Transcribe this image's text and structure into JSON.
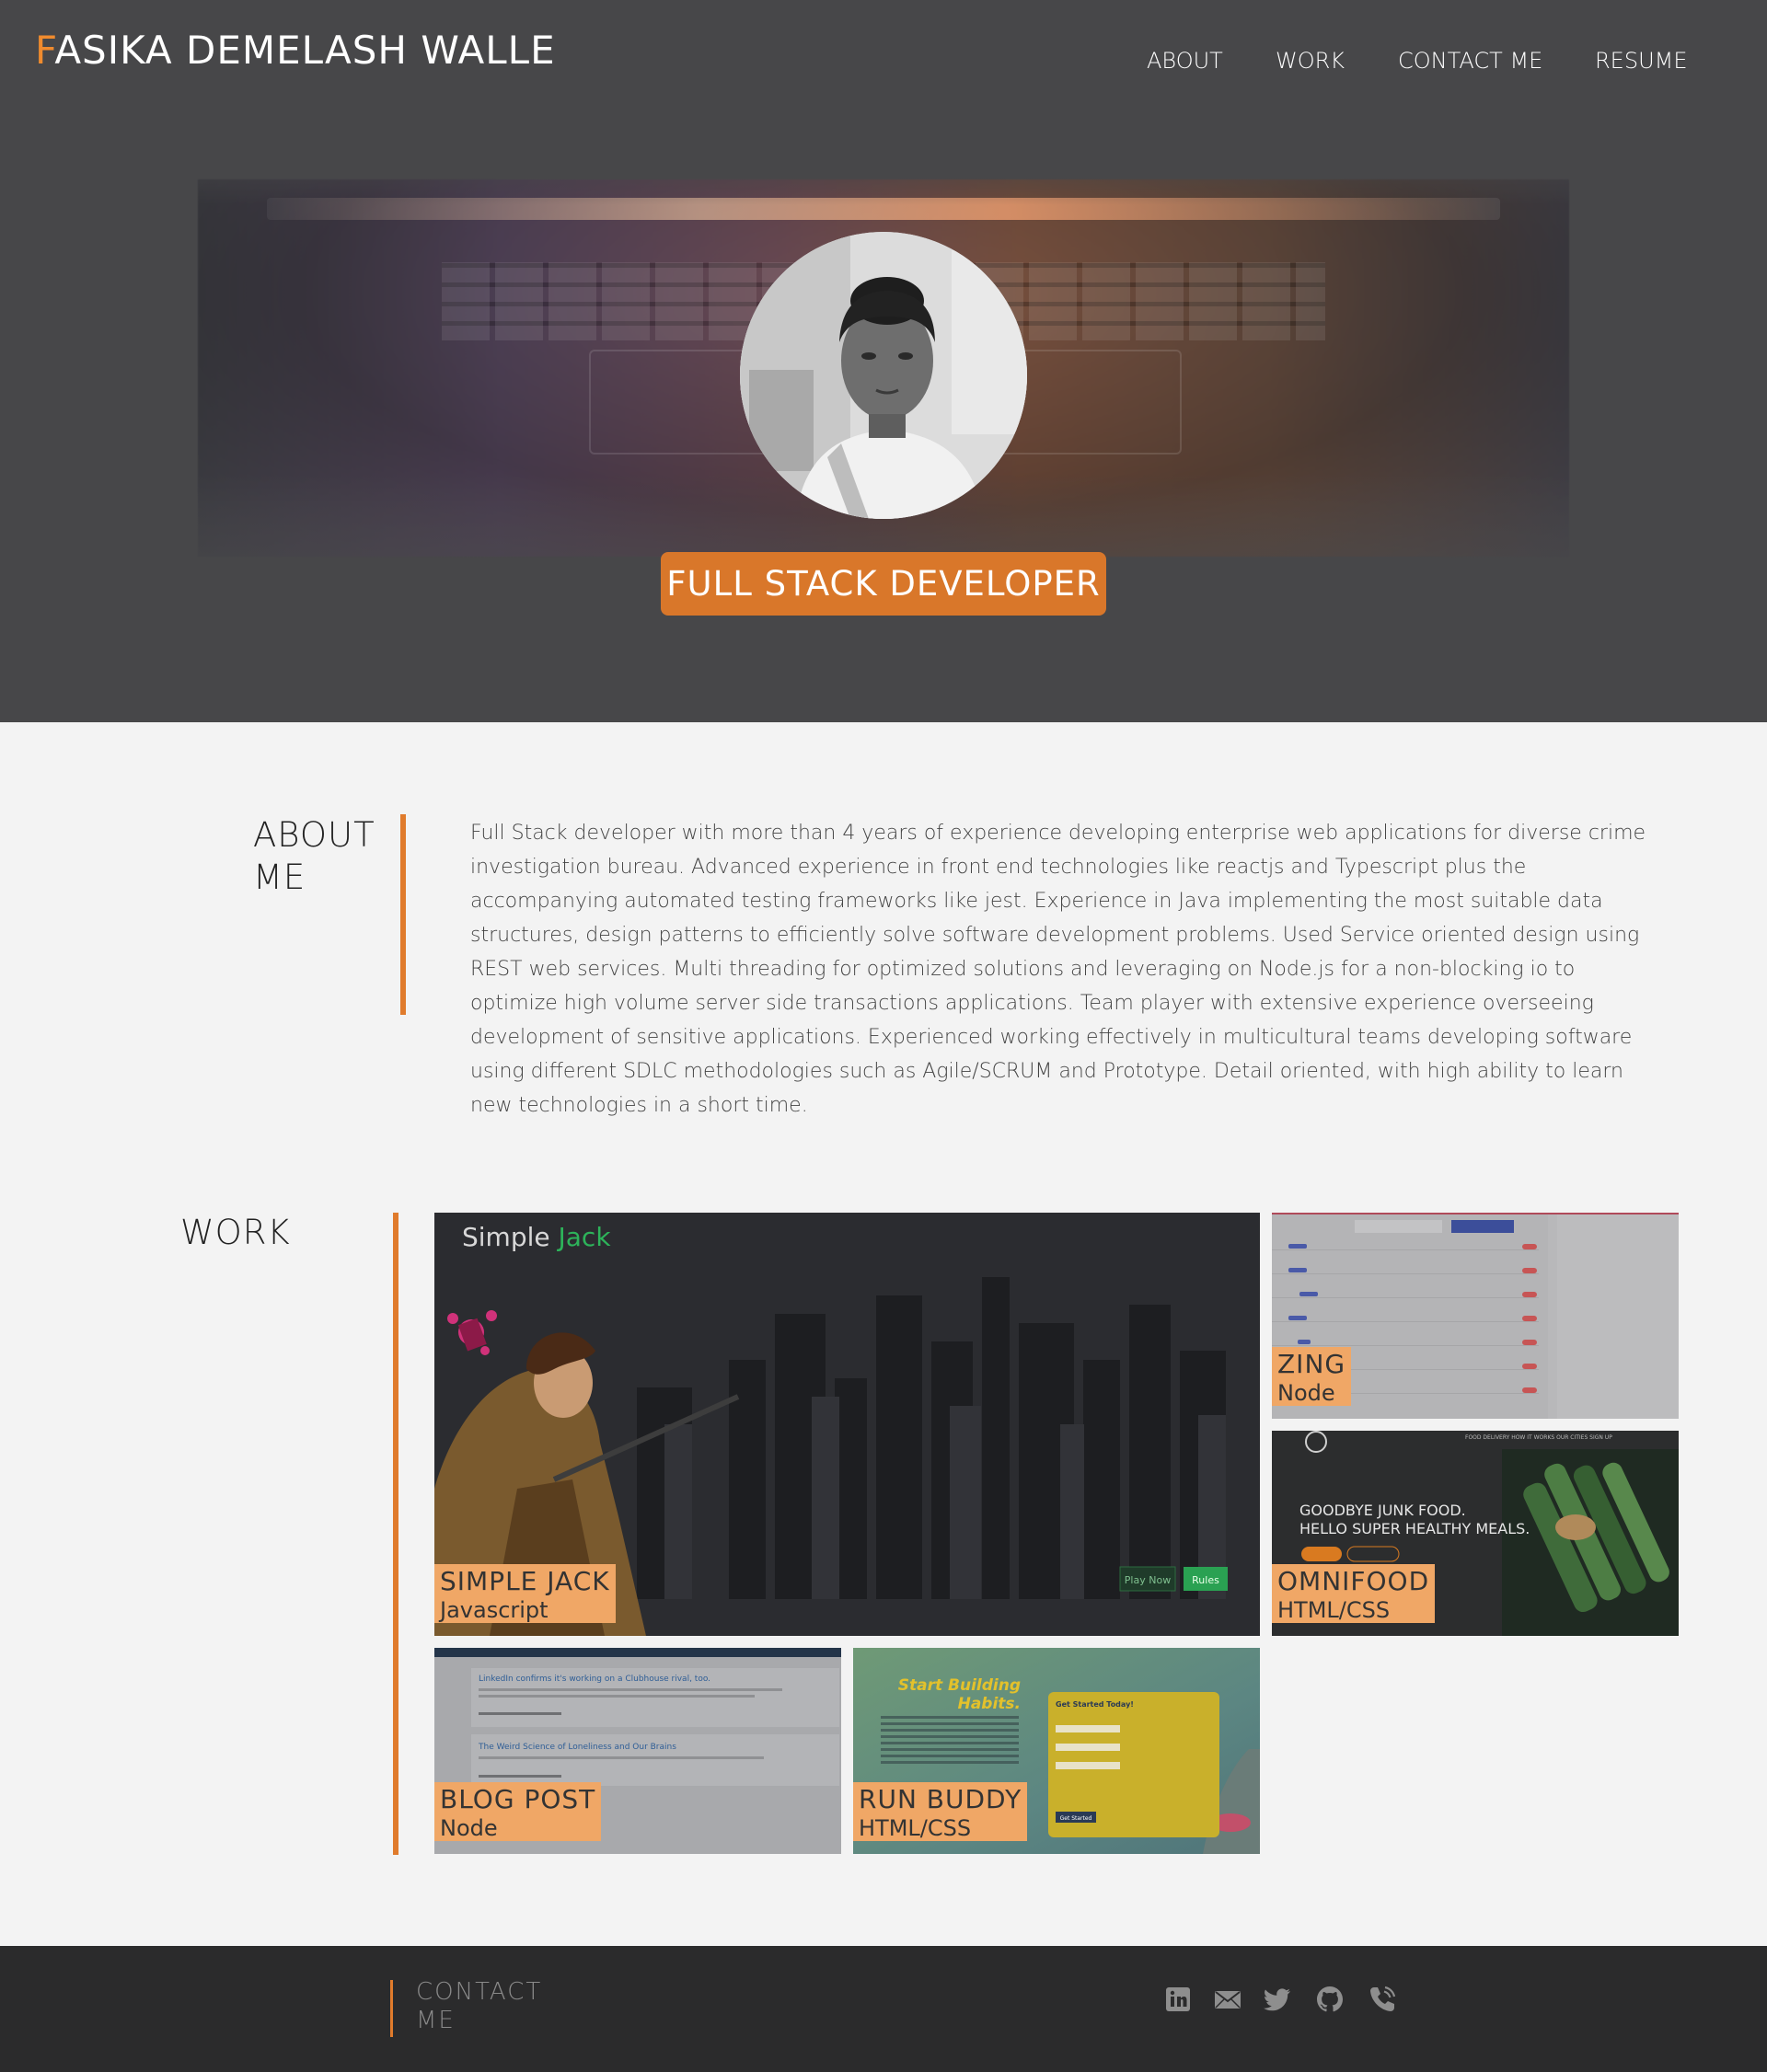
{
  "header": {
    "brand_initial": "F",
    "brand_rest": "ASIKA DEMELASH WALLE",
    "nav": [
      "ABOUT",
      "WORK",
      "CONTACT ME",
      "RESUME"
    ]
  },
  "hero": {
    "badge": "FULL STACK DEVELOPER"
  },
  "about": {
    "title": "ABOUT\nME",
    "text": "Full Stack developer with more than 4 years of experience developing enterprise web applications for diverse crime investigation bureau. Advanced experience in front end technologies like reactjs and Typescript plus the accompanying automated testing frameworks like jest. Experience in Java implementing the most suitable data structures, design patterns to efficiently solve software development problems. Used Service oriented design using REST web services. Multi threading for optimized solutions and leveraging on Node.js for a non-blocking io to optimize high volume server side transactions applications. Team player with extensive experience overseeing development of sensitive applications. Experienced working effectively in multicultural teams developing software using different SDLC methodologies such as Agile/SCRUM and Prototype. Detail oriented, with high ability to learn new technologies in a short time."
  },
  "work": {
    "title": "WORK",
    "projects": [
      {
        "name": "SIMPLE JACK",
        "tech": "Javascript"
      },
      {
        "name": "ZING",
        "tech": "Node"
      },
      {
        "name": "OMNIFOOD",
        "tech": "HTML/CSS"
      },
      {
        "name": "BLOG POST",
        "tech": "Node"
      },
      {
        "name": "RUN BUDDY",
        "tech": "HTML/CSS"
      }
    ],
    "screenshots": {
      "simple_jack": {
        "title_a": "Simple",
        "title_b": "Jack",
        "btn_play": "Play Now",
        "btn_rules": "Rules"
      },
      "omnifood": {
        "line1": "GOODBYE JUNK FOOD.",
        "line2": "HELLO SUPER HEALTHY MEALS."
      },
      "blog_post": {
        "post1": "LinkedIn confirms it's working on a Clubhouse rival, too.",
        "post2": "The Weird Science of Loneliness and Our Brains"
      },
      "run_buddy": {
        "headline1": "Start Building",
        "headline2": "Habits.",
        "form_title": "Get Started Today!",
        "form_btn": "Get Started"
      }
    }
  },
  "footer": {
    "title": "CONTACT\nME",
    "icons": [
      "linkedin-icon",
      "mail-icon",
      "twitter-icon",
      "github-icon",
      "phone-icon"
    ]
  },
  "colors": {
    "accent": "#e07b2c",
    "badge": "#d9772a",
    "label": "#f0a766",
    "hero_bg": "#474749",
    "footer_bg": "#2b2b2c",
    "page_bg": "#f3f3f3"
  }
}
